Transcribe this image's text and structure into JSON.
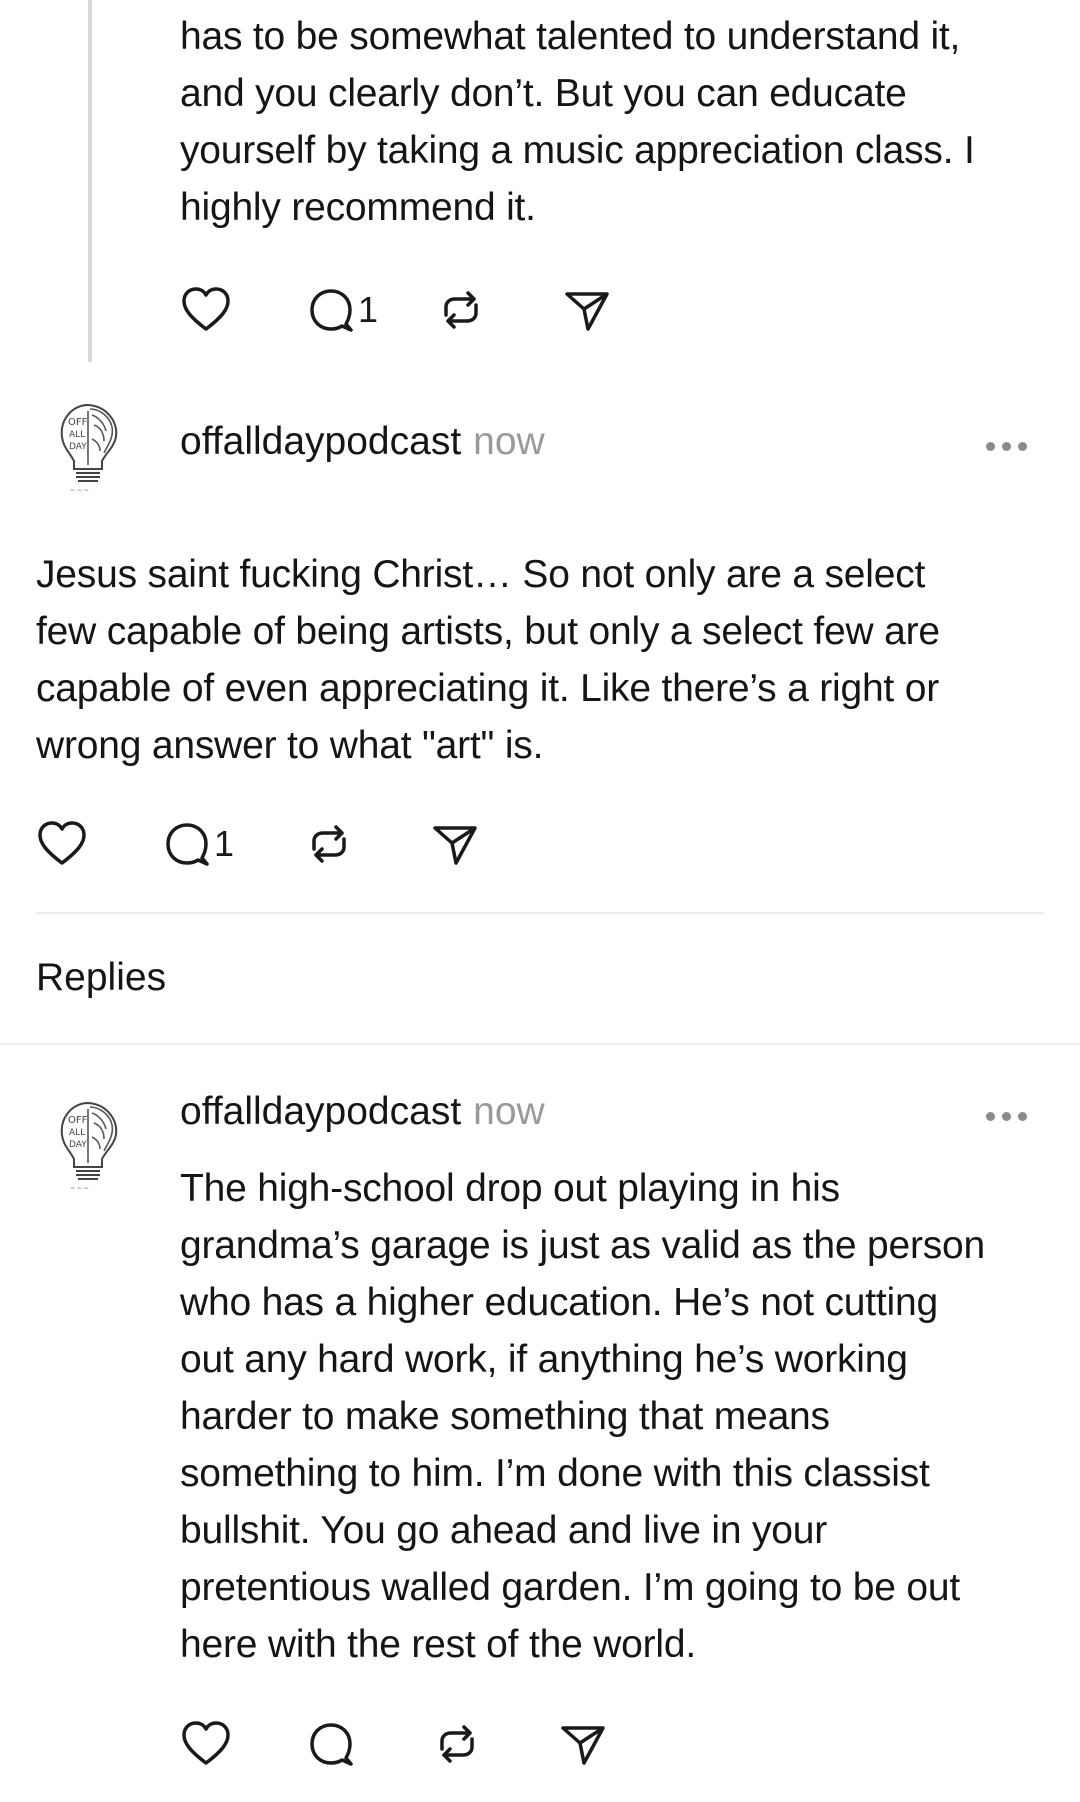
{
  "parent_post": {
    "text": "has to be somewhat talented to understand it,\nand you clearly don’t. But you can educate\nyourself by taking a music appreciation class. I\nhighly recommend it.",
    "reply_count": "1"
  },
  "main_post": {
    "author": "offalldaypodcast",
    "time": "now",
    "text": "Jesus saint fucking Christ… So not only are a select\nfew capable of being artists, but only a select few are\ncapable of even appreciating it. Like there’s a right or\nwrong answer to what \"art\" is.",
    "reply_count": "1"
  },
  "replies_section": {
    "title": "Replies"
  },
  "reply_post": {
    "author": "offalldaypodcast",
    "time": "now",
    "text": "The high-school drop out playing in his\ngrandma’s garage is just as valid as the person\nwho has a higher education. He’s not cutting\nout any hard work, if anything he’s working\nharder to make something that means\nsomething to him. I’m done with this classist\nbullshit. You go ahead and live in your\npretentious walled garden. I’m going to be out\nhere with the rest of the world."
  },
  "icons": {
    "like": "heart-icon",
    "reply": "comment-bubble-icon",
    "repost": "repost-arrows-icon",
    "share": "paper-plane-icon",
    "more": "ellipsis-icon"
  },
  "colors": {
    "text": "#151515",
    "muted": "#9a9a9a",
    "thread_line": "#d9d9d9",
    "divider": "#ececec"
  }
}
